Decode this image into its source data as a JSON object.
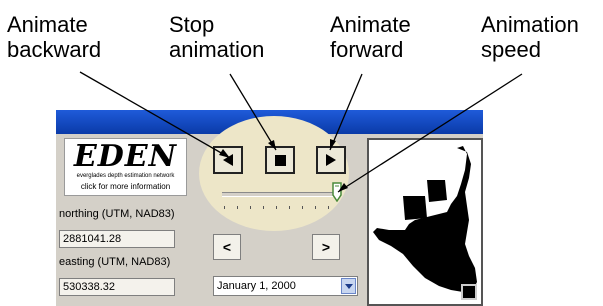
{
  "callouts": {
    "animate_backward": [
      "Animate",
      "backward"
    ],
    "stop_animation": [
      "Stop",
      "animation"
    ],
    "animate_forward": [
      "Animate",
      "forward"
    ],
    "animation_speed": [
      "Animation",
      "speed"
    ]
  },
  "logo": {
    "word": "EDEN",
    "subtitle": "everglades depth estimation network",
    "link": "click for more information"
  },
  "northing": {
    "label": "northing (UTM, NAD83)",
    "value": "2881041.28"
  },
  "easting": {
    "label": "easting (UTM, NAD83)",
    "value": "530338.32"
  },
  "date_select": {
    "value": "January 1, 2000"
  },
  "step_buttons": {
    "prev": "<",
    "next": ">"
  },
  "colors": {
    "titlebar": "#0a3aa8",
    "highlight": "#ede6c8",
    "panel": "#d4d0c8"
  }
}
